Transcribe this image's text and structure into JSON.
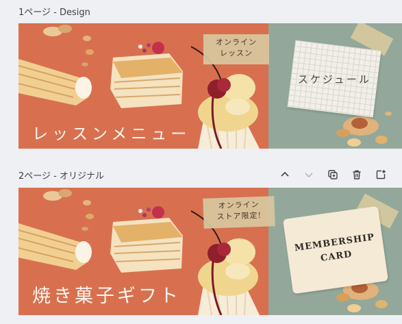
{
  "pages": [
    {
      "label": "1ページ - Design",
      "headline": "レッスンメニュー",
      "tape_line1": "オンライン",
      "tape_line2": "レッスン",
      "card_text": "スケジュール"
    },
    {
      "label": "2ページ - オリジナル",
      "headline": "焼き菓子ギフト",
      "tape_line1": "オンライン",
      "tape_line2": "ストア限定!",
      "card_line1": "MEMBERSHIP",
      "card_line2": "CARD"
    }
  ],
  "toolbar": {
    "icons": [
      "chevron-up-icon",
      "chevron-down-icon",
      "duplicate-icon",
      "trash-icon",
      "add-page-icon"
    ]
  },
  "colors": {
    "background": "#eef0f3",
    "banner_left": "#d8704f",
    "banner_right": "#93a89a",
    "headline_text": "#fbf6ee"
  }
}
